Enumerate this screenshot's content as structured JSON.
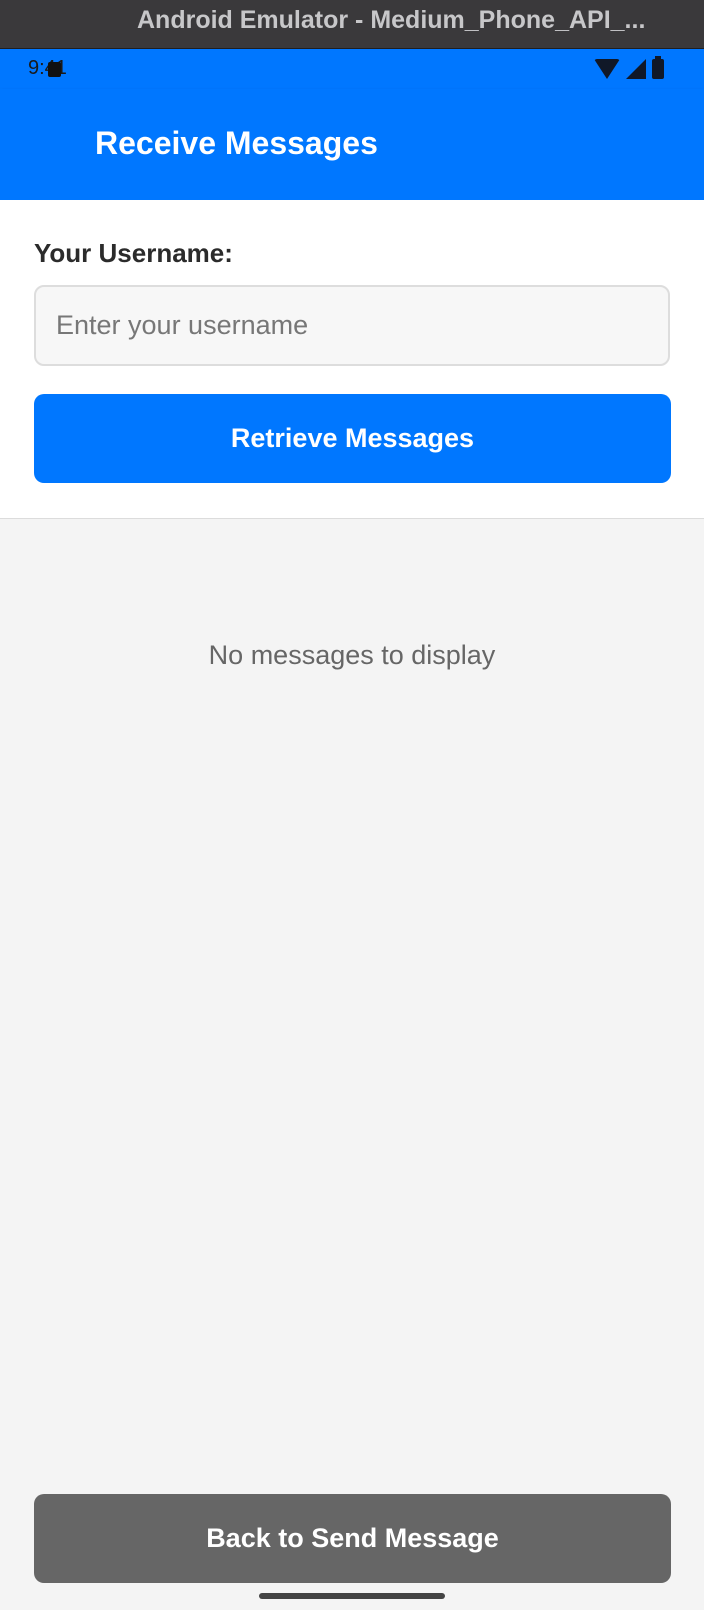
{
  "window": {
    "title": "Android Emulator - Medium_Phone_API_..."
  },
  "status_bar": {
    "time": "9:41",
    "icons": [
      "notification-icon",
      "wifi-icon",
      "signal-icon",
      "battery-icon"
    ]
  },
  "app_bar": {
    "title": "Receive Messages",
    "color": "#0077ff"
  },
  "form": {
    "username_label": "Your Username:",
    "username_placeholder": "Enter your username",
    "username_value": "",
    "retrieve_label": "Retrieve Messages"
  },
  "messages": {
    "empty_text": "No messages to display",
    "items": []
  },
  "footer": {
    "back_label": "Back to Send Message"
  },
  "colors": {
    "primary": "#0077ff",
    "secondary_button": "#666666",
    "background": "#f4f4f4"
  }
}
